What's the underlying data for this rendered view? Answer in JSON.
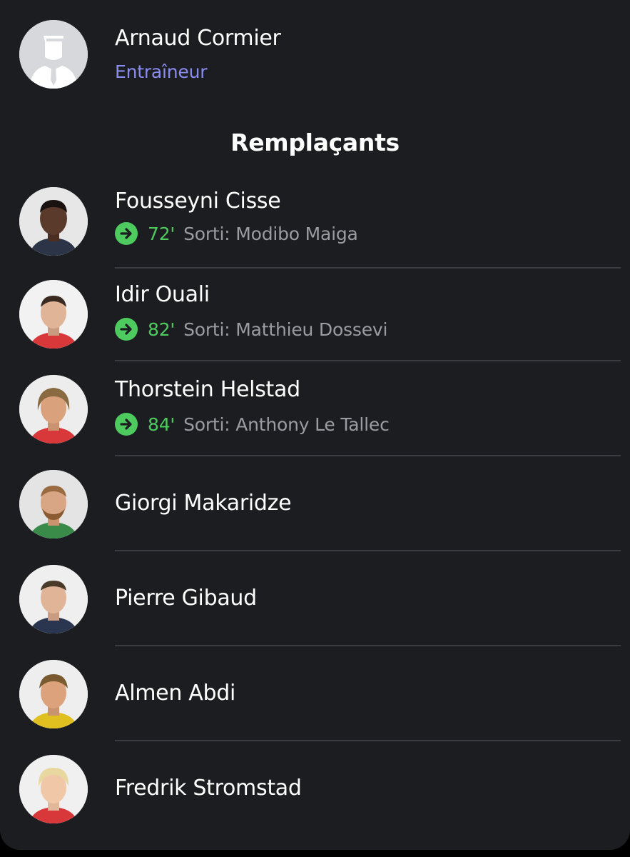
{
  "coach": {
    "name": "Arnaud Cormier",
    "role": "Entraîneur"
  },
  "section_title": "Remplaçants",
  "colors": {
    "background": "#1b1d20",
    "accent_role": "#8a8cf0",
    "sub_green": "#4ecb5f",
    "secondary_text": "#9a9ca1",
    "divider": "#3a3c41"
  },
  "substitutes": [
    {
      "name": "Fousseyni Cisse",
      "minute": "72'",
      "sortie": "Sorti: Modibo Maiga"
    },
    {
      "name": "Idir Ouali",
      "minute": "82'",
      "sortie": "Sorti: Matthieu Dossevi"
    },
    {
      "name": "Thorstein Helstad",
      "minute": "84'",
      "sortie": "Sorti: Anthony Le Tallec"
    },
    {
      "name": "Giorgi Makaridze"
    },
    {
      "name": "Pierre Gibaud"
    },
    {
      "name": "Almen Abdi"
    },
    {
      "name": "Fredrik Stromstad"
    }
  ]
}
